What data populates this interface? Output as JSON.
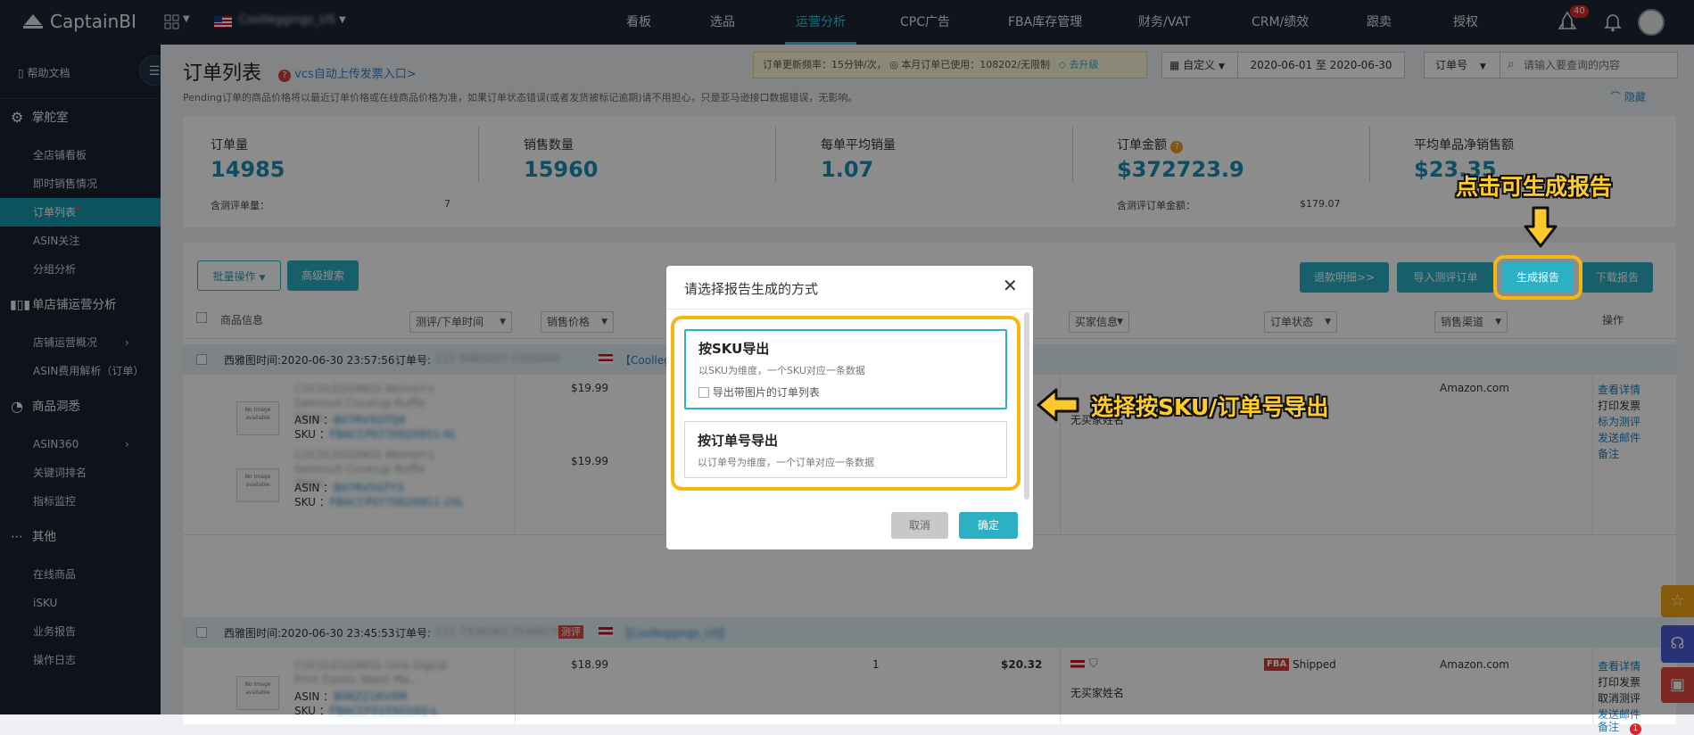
{
  "header": {
    "logo": "CaptainBI",
    "store": "Coolleggings_US",
    "nav": [
      "看板",
      "选品",
      "运营分析",
      "CPC广告",
      "FBA库存管理",
      "财务/VAT",
      "CRM/绩效",
      "跟卖",
      "授权"
    ],
    "active_nav": "运营分析",
    "notification_count": "40"
  },
  "sidebar": {
    "help": "帮助文档",
    "sections": [
      {
        "title": "掌舵室",
        "items": [
          "全店铺看板",
          "即时销售情况",
          "订单列表",
          "ASIN关注",
          "分组分析"
        ]
      },
      {
        "title": "单店铺运营分析",
        "items": [
          "店铺运营概况",
          "ASIN费用解析（订单）"
        ]
      },
      {
        "title": "商品洞悉",
        "items": [
          "ASIN360",
          "关键词排名",
          "指标监控"
        ]
      },
      {
        "title": "其他",
        "items": [
          "在线商品",
          "iSKU",
          "业务报告",
          "操作日志"
        ]
      }
    ],
    "active_item": "订单列表"
  },
  "page": {
    "title": "订单列表",
    "vcs_link": "vcs自动上传发票入口>",
    "notice": "Pending订单的商品价格将以最近订单价格或在线商品价格为准，如果订单状态错误(或者发货被标记逾期)请不用担心，只是亚马逊接口数据错误，无影响。",
    "update_info": "订单更新频率：15分钟/次，",
    "quota_info": "本月订单已使用：108202/无限制",
    "upgrade": "去升级",
    "date_mode": "自定义",
    "date_range": "2020-06-01 至 2020-06-30",
    "search_field": "订单号",
    "search_placeholder": "请输入要查询的内容",
    "hide": "隐藏"
  },
  "stats": [
    {
      "label": "订单量",
      "value": "14985",
      "sub_label": "含测评单量：",
      "sub_value": "7"
    },
    {
      "label": "销售数量",
      "value": "15960"
    },
    {
      "label": "每单平均销量",
      "value": "1.07"
    },
    {
      "label": "订单金额",
      "value": "$372723.9",
      "sub_label": "含测评订单金额：",
      "sub_value": "$179.07"
    },
    {
      "label": "平均单品净销售额",
      "value": "$23.35"
    }
  ],
  "toolbar": {
    "batch": "批量操作",
    "advanced": "高级搜索",
    "refund": "退款明细>>",
    "import": "导入测评订单",
    "generate": "生成报告",
    "download": "下载报告"
  },
  "table": {
    "columns": [
      "商品信息",
      "测评/下单时间",
      "销售价格",
      "买家信息",
      "订单状态",
      "销售渠道",
      "操作"
    ],
    "orders": [
      {
        "time": "西雅图时间:2020-06-30 23:57:56",
        "order_label": "订单号:",
        "order_no": "111-6481027-1331040",
        "store": "【Coolleggings_US】",
        "items": [
          {
            "title": "COCOLEGGINGS Women's Swimsuit Coverup Ruffle Sleev...",
            "asin": "B07RV5GTQ9",
            "sku": "FBACCP0770020911-XL",
            "price": "$19.99"
          },
          {
            "title": "COCOLEGGINGS Women's Swimsuit Coverup Ruffle Sleev...",
            "asin": "B07RV5GTY3",
            "sku": "FBACCP0770020911-2XL",
            "price": "$19.99"
          }
        ],
        "buyer": "无买家姓名",
        "channel": "Amazon.com",
        "actions": [
          "查看详情",
          "打印发票",
          "标为测评",
          "发送邮件",
          "备注"
        ]
      },
      {
        "time": "西雅图时间:2020-06-30 23:45:53",
        "order_label": "订单号:",
        "order_no": "111-7330165-3544829",
        "tag": "测评",
        "store": "【Coolleggings_US】",
        "items": [
          {
            "title": "COCOLEGGINGS Girls Digital Print Elastic Waist Ma...",
            "asin": "B06ZZ1KVXM",
            "sku": "FBACCF0155010Q-L",
            "price": "$18.99",
            "qty": "1",
            "amount": "$20.32"
          }
        ],
        "buyer": "无买家姓名",
        "fba": "FBA",
        "status": "Shipped",
        "channel": "Amazon.com",
        "actions": [
          "查看详情",
          "打印发票",
          "取消测评",
          "发送邮件",
          "备注"
        ],
        "remark_count": "1"
      }
    ],
    "no_image": "No Image available"
  },
  "modal": {
    "title": "请选择报告生成的方式",
    "option1_title": "按SKU导出",
    "option1_desc": "以SKU为维度，一个SKU对应一条数据",
    "option1_check": "导出带图片的订单列表",
    "option2_title": "按订单号导出",
    "option2_desc": "以订单号为维度，一个订单对应一条数据",
    "cancel": "取消",
    "confirm": "确定"
  },
  "annotations": {
    "top": "点击可生成报告",
    "side": "选择按SKU/订单号导出"
  },
  "colors": {
    "accent": "#2bb0c4",
    "highlight": "#f6b711",
    "callout_text": "#ffcc2e",
    "nav_bg": "#1c2535"
  }
}
